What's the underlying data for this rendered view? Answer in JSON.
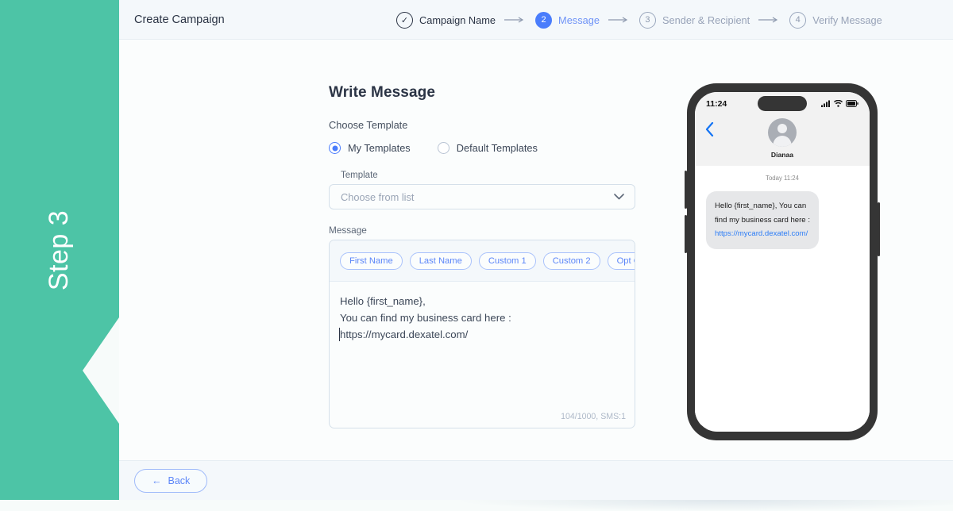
{
  "step_panel": {
    "label": "Step 3"
  },
  "topbar": {
    "title": "Create Campaign",
    "steps": [
      {
        "marker": "✓",
        "label": "Campaign Name",
        "state": "done"
      },
      {
        "marker": "2",
        "label": "Message",
        "state": "active"
      },
      {
        "marker": "3",
        "label": "Sender & Recipient",
        "state": "todo"
      },
      {
        "marker": "4",
        "label": "Verify Message",
        "state": "todo"
      }
    ]
  },
  "form": {
    "title": "Write Message",
    "choose_template_label": "Choose Template",
    "radios": [
      {
        "label": "My Templates",
        "selected": true
      },
      {
        "label": "Default Templates",
        "selected": false
      }
    ],
    "template_label": "Template",
    "template_placeholder": "Choose from list",
    "template_value": "",
    "chevron_icon": "chevron-down",
    "message_label": "Message",
    "chips": [
      "First Name",
      "Last Name",
      "Custom 1",
      "Custom 2",
      "Opt Out"
    ],
    "message_lines": [
      "Hello {first_name},",
      "You can find my business card here :",
      "https://mycard.dexatel.com/"
    ],
    "counter": "104/1000, SMS:1"
  },
  "phone": {
    "status_time": "11:24",
    "contact_name": "Dianaa",
    "chat_timestamp": "Today 11:24",
    "bubble_text": "Hello {first_name}, You can find my business card here : ",
    "bubble_link": "https://mycard.dexatel.com/"
  },
  "bottombar": {
    "back_label": "Back",
    "back_arrow": "←"
  },
  "colors": {
    "green": "#4dc4a6",
    "blue": "#4a7dfc",
    "link_blue": "#2b7cf6",
    "text_dark": "#2b3445"
  }
}
